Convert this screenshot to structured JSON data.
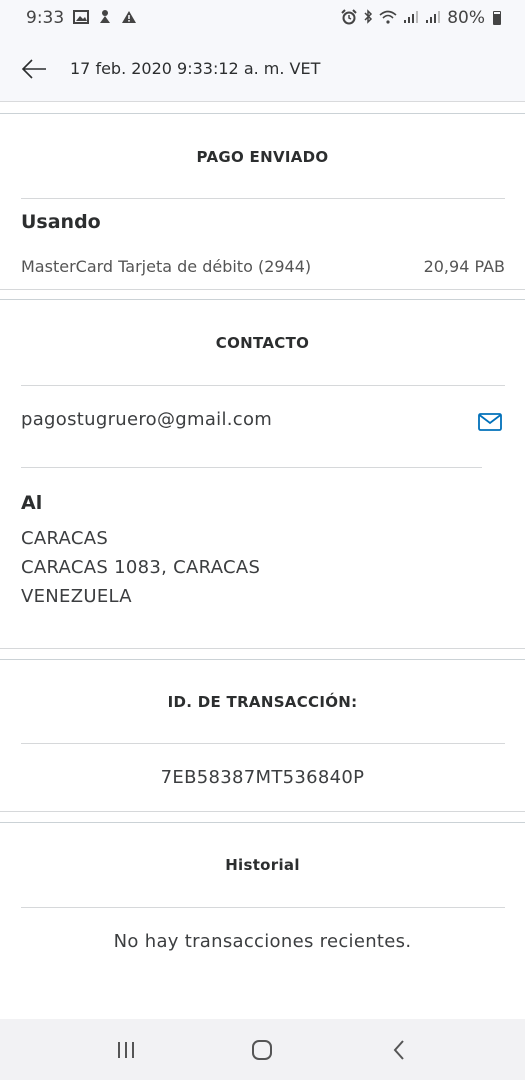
{
  "status_bar": {
    "time": "9:33",
    "battery_percent": "80%"
  },
  "app_bar": {
    "title": "17 feb. 2020 9:33:12 a. m. VET"
  },
  "payment": {
    "header": "PAGO ENVIADO",
    "using_label": "Usando",
    "method": "MasterCard Tarjeta de débito (2944)",
    "amount": "20,94 PAB"
  },
  "contact": {
    "header": "CONTACTO",
    "email": "pagostugruero@gmail.com",
    "to_label": "Al",
    "address_lines": [
      "CARACAS",
      "CARACAS 1083, CARACAS",
      "VENEZUELA"
    ]
  },
  "transaction": {
    "header": "ID. DE TRANSACCIÓN:",
    "id": "7EB58387MT536840P"
  },
  "history": {
    "header": "Historial",
    "empty_message": "No hay transacciones recientes."
  },
  "nav": {
    "items": [
      "recent-apps",
      "home",
      "back"
    ]
  },
  "colors": {
    "accent": "#0070ba",
    "text": "#2c2e2f",
    "divider": "#d6d8da",
    "appbar_bg": "#f7f8fb"
  }
}
